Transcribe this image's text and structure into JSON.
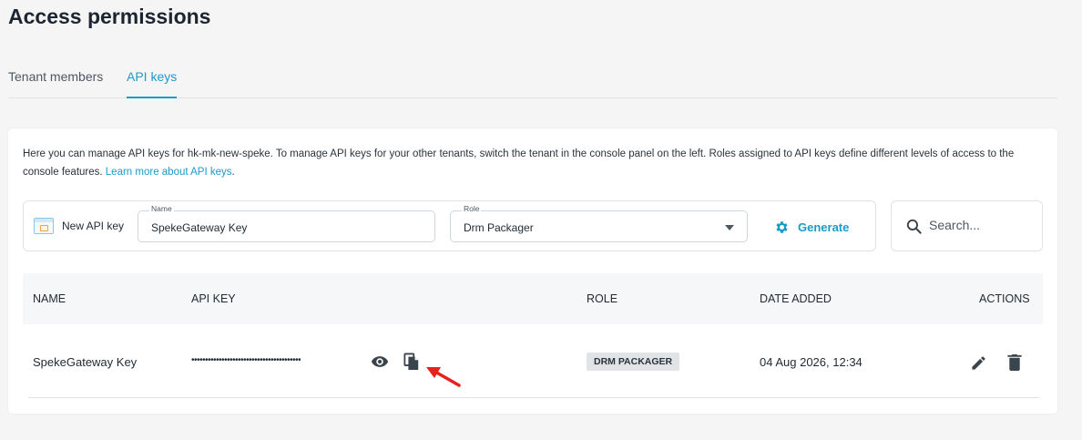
{
  "page": {
    "title": "Access permissions"
  },
  "tabs": [
    {
      "label": "Tenant members",
      "active": false
    },
    {
      "label": "API keys",
      "active": true
    }
  ],
  "description": {
    "text": "Here you can manage API keys for hk-mk-new-speke. To manage API keys for your other tenants, switch the tenant in the console panel on the left. Roles assigned to API keys define different levels of access to the console features. ",
    "link": "Learn more about API keys",
    "suffix": "."
  },
  "new_key": {
    "label": "New API key",
    "name_label": "Name",
    "name_value": "SpekeGateway Key",
    "role_label": "Role",
    "role_value": "Drm Packager",
    "generate_label": "Generate"
  },
  "search": {
    "placeholder": "Search..."
  },
  "table": {
    "headers": {
      "name": "NAME",
      "api_key": "API KEY",
      "role": "ROLE",
      "date": "DATE ADDED",
      "actions": "ACTIONS"
    },
    "rows": [
      {
        "name": "SpekeGateway Key",
        "api_key_masked": "••••••••••••••••••••••••••••••••••••••••",
        "role": "DRM PACKAGER",
        "date": "04 Aug 2026, 12:34"
      }
    ]
  },
  "colors": {
    "accent": "#1a9bc8",
    "arrow": "#e8201e"
  }
}
